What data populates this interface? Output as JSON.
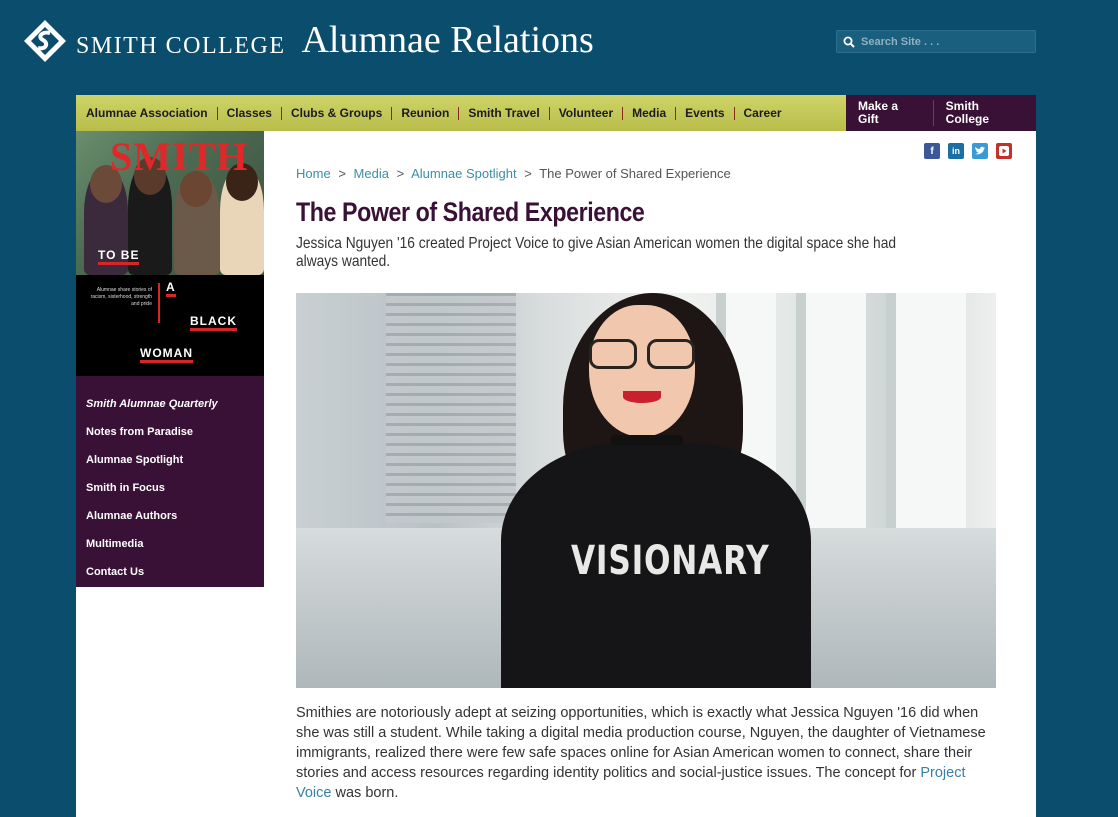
{
  "header": {
    "college": "SMITH COLLEGE",
    "site_title": "Alumnae Relations",
    "search_placeholder": "Search Site . . ."
  },
  "nav": {
    "items": [
      "Alumnae Association",
      "Classes",
      "Clubs & Groups",
      "Reunion",
      "Smith Travel",
      "Volunteer",
      "Media",
      "Events",
      "Career"
    ],
    "right_items": [
      "Make a Gift",
      "Smith College"
    ]
  },
  "cover": {
    "title": "SMITH",
    "words": [
      "TO BE",
      "A",
      "BLACK",
      "WOMAN"
    ],
    "blurb": "Alumnae share stories of racism, sisterhood, strength and pride"
  },
  "sidebar": {
    "items": [
      "Smith Alumnae Quarterly",
      "Notes from Paradise",
      "Alumnae Spotlight",
      "Smith in Focus",
      "Alumnae Authors",
      "Multimedia",
      "Contact Us"
    ]
  },
  "social": {
    "icons": [
      "facebook-icon",
      "linkedin-icon",
      "twitter-icon",
      "youtube-icon"
    ],
    "colors": [
      "#3b5998",
      "#1b6fa5",
      "#3a9bd4",
      "#c4302b"
    ]
  },
  "breadcrumb": {
    "items": [
      "Home",
      "Media",
      "Alumnae Spotlight"
    ],
    "current": "The Power of Shared Experience",
    "separator": ">"
  },
  "article": {
    "title": "The Power of Shared Experience",
    "subtitle": "Jessica Nguyen '16 created Project Voice to give Asian American women the digital space she had always wanted.",
    "photo_text": "VISIONARY",
    "body_before_link": "Smithies are notoriously adept at seizing opportunities, which is exactly what Jessica Nguyen '16 did when she was still a student. While taking a digital media production course, Nguyen, the daughter of Vietnamese immigrants, realized there were few safe spaces online for Asian American women to connect, share their stories and access resources regarding identity politics and social-justice issues. The concept for ",
    "body_link": "Project Voice",
    "body_after_link": " was born."
  }
}
